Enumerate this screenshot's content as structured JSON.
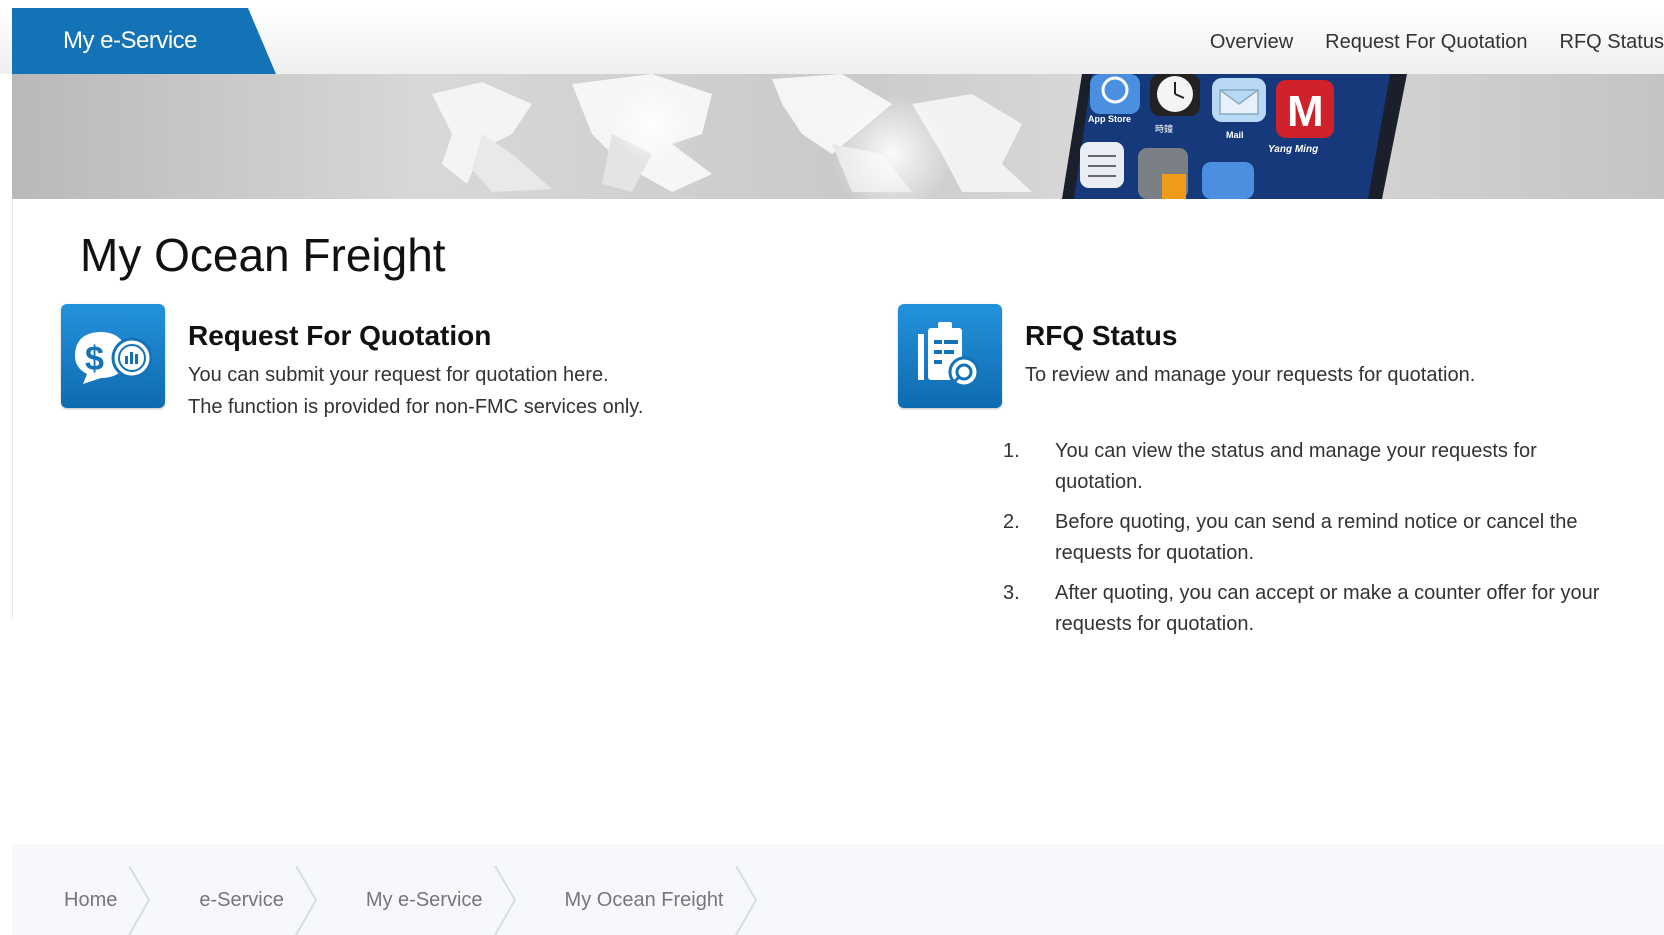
{
  "header": {
    "brand": "My e-Service",
    "nav": [
      "Overview",
      "Request For Quotation",
      "RFQ Status"
    ]
  },
  "banner": {
    "app_labels": [
      "App Store",
      "時鐘",
      "Mail",
      "Yang Ming"
    ]
  },
  "main": {
    "title": "My Ocean Freight",
    "cards": [
      {
        "icon": "dollar-quote-icon",
        "title": "Request For Quotation",
        "lines": [
          "You can submit your request for quotation here.",
          "The function is provided for non-FMC services only."
        ]
      },
      {
        "icon": "clipboard-search-icon",
        "title": "RFQ Status",
        "lines": [
          "To review and manage your requests for quotation."
        ],
        "list": [
          {
            "num": "1.",
            "line1": "You can view the status and manage your requests for",
            "line2": "quotation."
          },
          {
            "num": "2.",
            "line1": "Before quoting, you can send a remind notice or cancel the",
            "line2": "requests for quotation."
          },
          {
            "num": "3.",
            "line1": "After quoting, you can accept or make a counter offer for your",
            "line2": "requests for quotation."
          }
        ]
      }
    ]
  },
  "breadcrumb": [
    "Home",
    "e-Service",
    "My e-Service",
    "My Ocean Freight"
  ],
  "colors": {
    "brand_blue": "#1473b6",
    "icon_blue": "#1a86cf",
    "text": "#333333"
  }
}
